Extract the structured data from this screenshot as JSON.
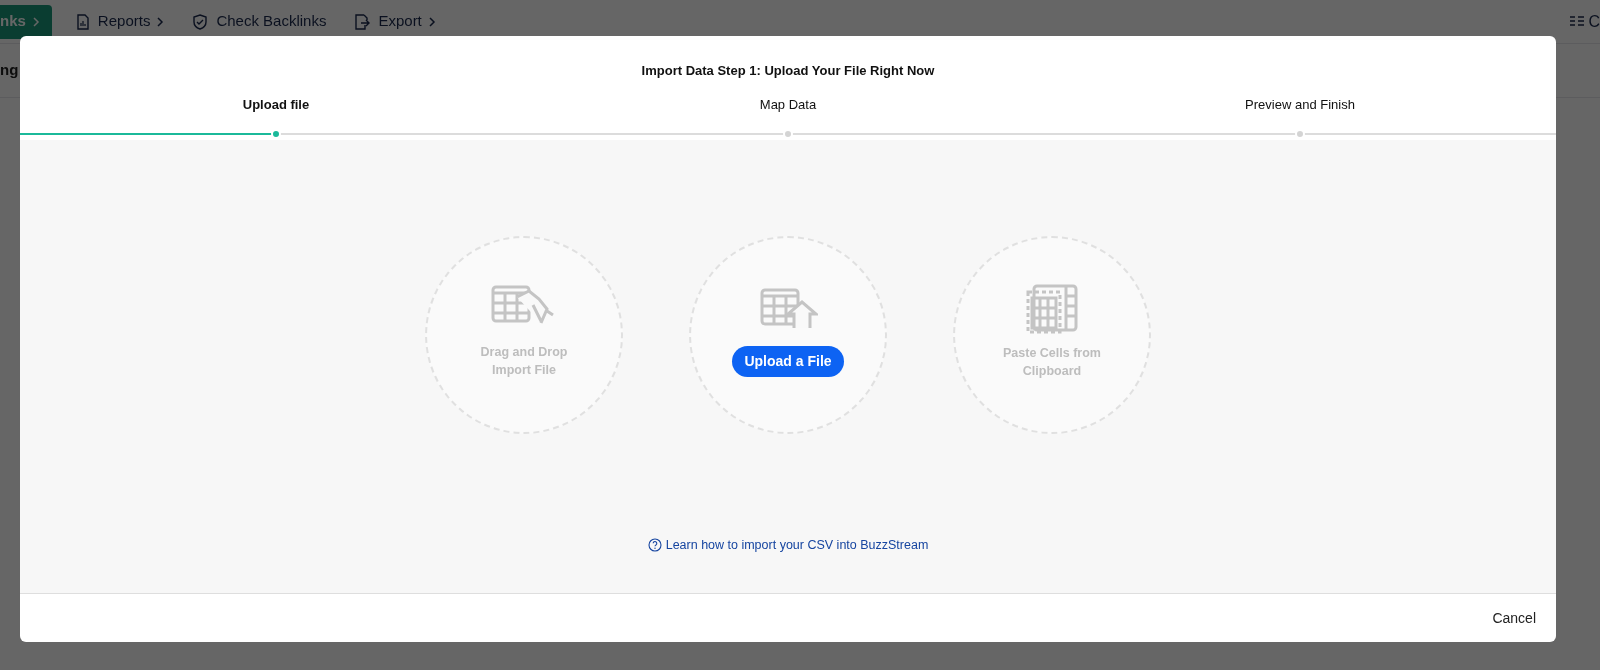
{
  "background": {
    "toolbar": [
      {
        "label": "nks",
        "kind": "primary"
      },
      {
        "label": "Reports",
        "kind": "report"
      },
      {
        "label": "Check Backlinks",
        "kind": "shield"
      },
      {
        "label": "Export",
        "kind": "export"
      }
    ],
    "right_label": "C",
    "side_label": "ng"
  },
  "dialog": {
    "title": "Import Data Step 1: Upload Your File Right Now",
    "steps": [
      {
        "label": "Upload file",
        "selected": true
      },
      {
        "label": "Map Data",
        "selected": false
      },
      {
        "label": "Preview and Finish",
        "selected": false
      }
    ],
    "options": [
      {
        "kind": "drop",
        "label": "Drag and Drop Import File"
      },
      {
        "kind": "upload",
        "label": "Upload a File"
      },
      {
        "kind": "paste",
        "label": "Paste Cells from Clipboard"
      }
    ],
    "help_link": "Learn how to import your CSV into BuzzStream",
    "cancel": "Cancel"
  }
}
